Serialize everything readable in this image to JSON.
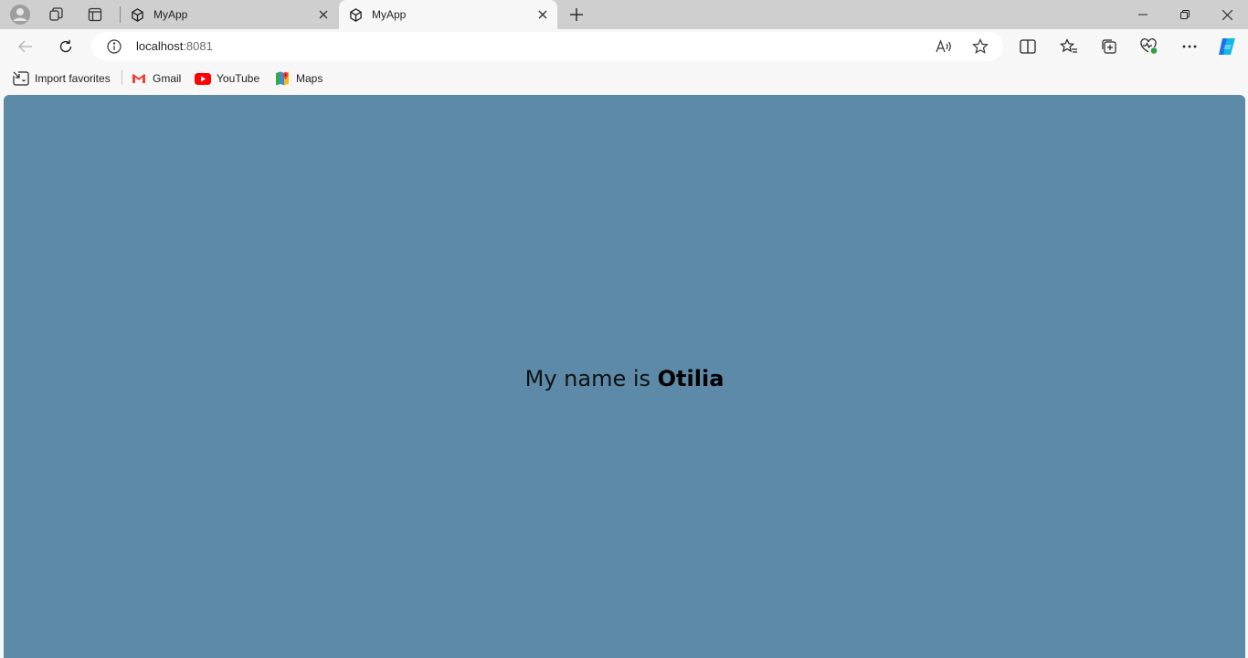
{
  "browser": {
    "tabs": [
      {
        "title": "MyApp",
        "active": false
      },
      {
        "title": "MyApp",
        "active": true
      }
    ],
    "address": {
      "host": "localhost",
      "port": ":8081"
    },
    "bookmarks": [
      {
        "label": "Import favorites",
        "icon": "import-favorites-icon"
      },
      {
        "label": "Gmail",
        "icon": "gmail-icon"
      },
      {
        "label": "YouTube",
        "icon": "youtube-icon"
      },
      {
        "label": "Maps",
        "icon": "maps-icon"
      }
    ]
  },
  "page": {
    "background": "#5d8aa8",
    "greeting_prefix": "My name is ",
    "name": "Otilia"
  }
}
